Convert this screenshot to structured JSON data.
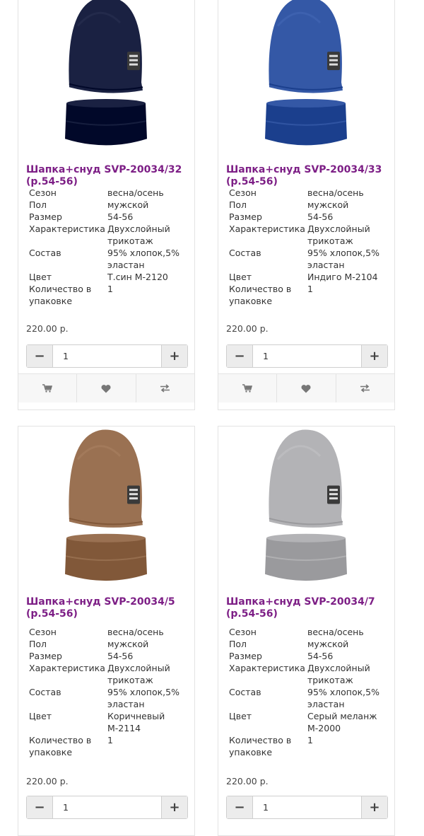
{
  "products": [
    {
      "title": "Шапка+снуд SVP-20034/32 (р.54-56)",
      "hat_color": "#1a2142",
      "specs": [
        {
          "name": "Сезон",
          "value": "весна/осень"
        },
        {
          "name": "Пол",
          "value": "мужской"
        },
        {
          "name": "Размер",
          "value": "54-56"
        },
        {
          "name": "Характеристика",
          "value": "Двухслойный трикотаж"
        },
        {
          "name": "Состав",
          "value": "95% хлопок,5% эластан"
        },
        {
          "name": "Цвет",
          "value": "Т.син М-2120"
        },
        {
          "name": "Количество в упаковке",
          "value": "1"
        }
      ],
      "price": "220.00 р.",
      "quantity": "1"
    },
    {
      "title": "Шапка+снуд SVP-20034/33 (р.54-56)",
      "hat_color": "#3458a6",
      "specs": [
        {
          "name": "Сезон",
          "value": "весна/осень"
        },
        {
          "name": "Пол",
          "value": "мужской"
        },
        {
          "name": "Размер",
          "value": "54-56"
        },
        {
          "name": "Характеристика",
          "value": "Двухслойный трикотаж"
        },
        {
          "name": "Состав",
          "value": "95% хлопок,5% эластан"
        },
        {
          "name": "Цвет",
          "value": "Индиго М-2104"
        },
        {
          "name": "Количество в упаковке",
          "value": "1"
        }
      ],
      "price": "220.00 р.",
      "quantity": "1"
    },
    {
      "title": "Шапка+снуд SVP-20034/5 (р.54-56)",
      "hat_color": "#9a7152",
      "specs": [
        {
          "name": "Сезон",
          "value": "весна/осень"
        },
        {
          "name": "Пол",
          "value": "мужской"
        },
        {
          "name": "Размер",
          "value": "54-56"
        },
        {
          "name": "Характеристика",
          "value": "Двухслойный трикотаж"
        },
        {
          "name": "Состав",
          "value": "95% хлопок,5% эластан"
        },
        {
          "name": "Цвет",
          "value": "Коричневый М-2114"
        },
        {
          "name": "Количество в упаковке",
          "value": "1"
        }
      ],
      "price": "220.00 р.",
      "quantity": "1"
    },
    {
      "title": "Шапка+снуд SVP-20034/7 (р.54-56)",
      "hat_color": "#b3b3b6",
      "specs": [
        {
          "name": "Сезон",
          "value": "весна/осень"
        },
        {
          "name": "Пол",
          "value": "мужской"
        },
        {
          "name": "Размер",
          "value": "54-56"
        },
        {
          "name": "Характеристика",
          "value": "Двухслойный трикотаж"
        },
        {
          "name": "Состав",
          "value": "95% хлопок,5% эластан"
        },
        {
          "name": "Цвет",
          "value": "Серый меланж М-2000"
        },
        {
          "name": "Количество в упаковке",
          "value": "1"
        }
      ],
      "price": "220.00 р.",
      "quantity": "1"
    }
  ],
  "ui": {
    "minus_label": "−",
    "plus_label": "+",
    "accent_color": "#7d1f86",
    "action_icons": [
      "cart-icon",
      "heart-icon",
      "compare-icon"
    ]
  }
}
